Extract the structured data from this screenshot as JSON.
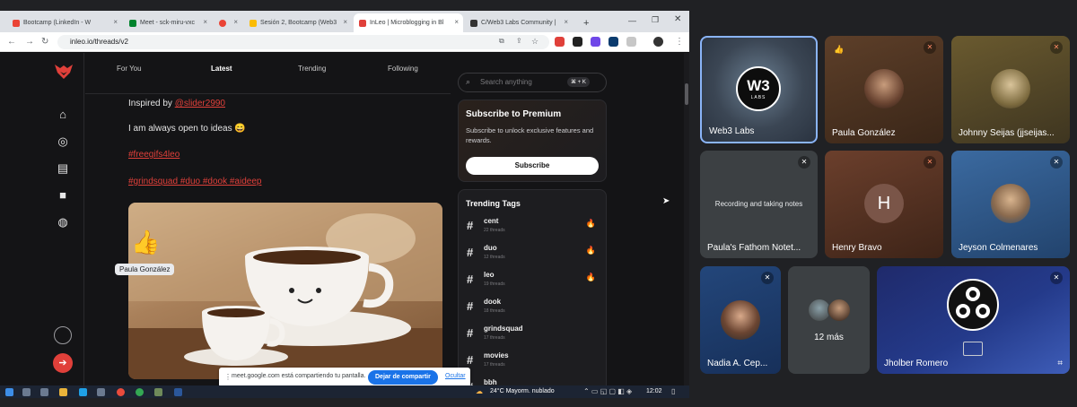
{
  "browser": {
    "tabs": [
      {
        "label": "Bootcamp (LinkedIn - W",
        "color": "#ea4335"
      },
      {
        "label": "Meet - sck-miru-vxc",
        "color": "#00832d"
      },
      {
        "label": "",
        "color": "#ea4335"
      },
      {
        "label": "Sesión 2, Bootcamp (Web3",
        "color": "#fbbc04"
      },
      {
        "label": "InLeo | Microblogging in Bl",
        "color": "#e0403a"
      },
      {
        "label": "C/Web3 Labs Community |",
        "color": "#333333"
      }
    ],
    "new_tab": "+",
    "url": "inleo.io/threads/v2"
  },
  "app": {
    "feed_tabs": [
      "For You",
      "Latest",
      "Trending",
      "Following"
    ],
    "post": {
      "inspired_prefix": "Inspired by ",
      "inspired_user": "@slider2990",
      "line2": "I am always open to ideas 😄",
      "hashtag1": "#freegifs4leo",
      "hashtags2": "#grindsquad #duo #dook #aideep"
    },
    "search_placeholder": "Search anything",
    "search_shortcut": "⌘ + K",
    "premium": {
      "title": "Subscribe to Premium",
      "body": "Subscribe to unlock exclusive features and rewards.",
      "button": "Subscribe"
    },
    "trending": {
      "title": "Trending Tags",
      "tags": [
        {
          "name": "cent",
          "count": "22 threads",
          "hot": true
        },
        {
          "name": "duo",
          "count": "12 threads",
          "hot": true
        },
        {
          "name": "leo",
          "count": "19 threads",
          "hot": true
        },
        {
          "name": "dook",
          "count": "18 threads",
          "hot": false
        },
        {
          "name": "grindsquad",
          "count": "17 threads",
          "hot": false
        },
        {
          "name": "movies",
          "count": "17 threads",
          "hot": false
        },
        {
          "name": "bbh",
          "count": "",
          "hot": false
        }
      ]
    },
    "overlay_name": "Paula González"
  },
  "share_bar": {
    "text": "meet.google.com está compartiendo tu pantalla.",
    "stop": "Dejar de compartir",
    "hide": "Ocultar"
  },
  "taskbar": {
    "weather": "24°C  Mayorm. nublado",
    "time": "12:02"
  },
  "meet": {
    "tiles": [
      {
        "name": "Web3 Labs",
        "logo": "W3",
        "logo_sub": "LABS"
      },
      {
        "name": "Paula González"
      },
      {
        "name": "Johnny Seijas (jjseijas..."
      },
      {
        "name": "Paula's Fathom Notet...",
        "status": "Recording and taking notes"
      },
      {
        "name": "Henry Bravo",
        "initial": "H"
      },
      {
        "name": "Jeyson Colmenares"
      },
      {
        "name": "Nadia A. Cep..."
      },
      {
        "name": "",
        "more": "12 más"
      },
      {
        "name": "Jholber Romero"
      }
    ]
  },
  "colors": {
    "accent": "#e0403a",
    "meet_active": "#8ab4f8",
    "share_btn": "#1a73e8"
  }
}
